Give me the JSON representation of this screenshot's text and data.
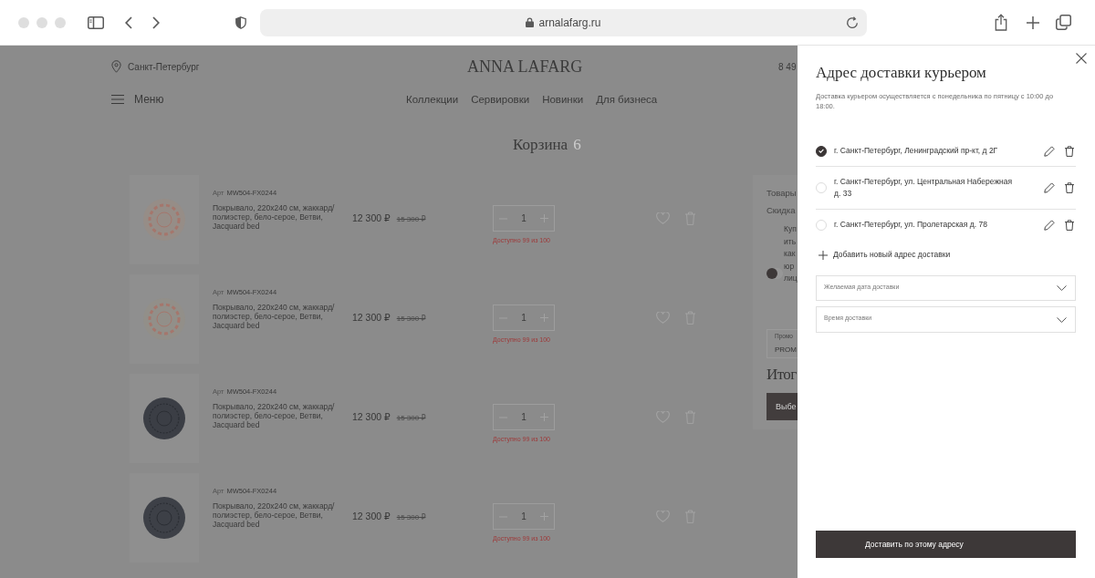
{
  "browser": {
    "url": "arnalafarg.ru"
  },
  "header": {
    "city": "Санкт-Петербург",
    "logo": "ANNA LAFARG",
    "phone": "8 49",
    "menu_label": "Меню",
    "nav": [
      "Коллекции",
      "Сервировки",
      "Новинки",
      "Для бизнеса"
    ]
  },
  "cart": {
    "title": "Корзина",
    "count": "6",
    "items": [
      {
        "article_label": "Арт",
        "article": "MW504-FX0244",
        "name": "Покрывало, 220х240 см, жаккард/полиэстер, бело-серое, Ветви, Jacquard bed",
        "price": "12 300 ₽",
        "old_price": "15 300 ₽",
        "quantity": "1",
        "stock": "Доступно 99 из 100",
        "photo": {
          "color": "#968d87"
        }
      },
      {
        "article_label": "Арт",
        "article": "MW504-FX0244",
        "name": "Покрывало, 220х240 см, жаккард/полиэстер, бело-серое, Ветви, Jacquard bed",
        "price": "12 300 ₽",
        "old_price": "15 300 ₽",
        "quantity": "1",
        "stock": "Доступно 99 из 100",
        "photo": {
          "color": "#928f89"
        }
      },
      {
        "article_label": "Арт",
        "article": "MW504-FX0244",
        "name": "Покрывало, 220х240 см, жаккард/полиэстер, бело-серое, Ветви, Jacquard bed",
        "price": "12 300 ₽",
        "old_price": "15 300 ₽",
        "quantity": "1",
        "stock": "Доступно 99 из 100",
        "photo": {
          "color": "#3b3e45"
        }
      },
      {
        "article_label": "Арт",
        "article": "MW504-FX0244",
        "name": "Покрывало, 220х240 см, жаккард/полиэстер, бело-серое, Ветви, Jacquard bed",
        "price": "12 300 ₽",
        "old_price": "15 300 ₽",
        "quantity": "1",
        "stock": "Доступно 99 из 100",
        "photo": {
          "color": "#3d4047"
        }
      }
    ]
  },
  "summary": {
    "lines": [
      "Товары",
      "Скидка"
    ],
    "legal_entity": {
      "label": "Купить как юр лиц",
      "on": false
    },
    "promo": {
      "label": "Промо",
      "value": "PROM"
    },
    "total_label": "Итог",
    "button": "Выбе"
  },
  "panel": {
    "title": "Адрес доставки курьером",
    "description": "Доставка курьером осуществляется с понедельника по пятницу с 10:00 до 18:00.",
    "addresses": [
      {
        "text": "г. Санкт-Петербург, Ленинградский пр-кт, д 2Г",
        "selected": true
      },
      {
        "text": "г. Санкт-Петербург, ул. Центральная Набережная д. 33",
        "selected": false
      },
      {
        "text": "г. Санкт-Петербург, ул. Пролетарская д. 78",
        "selected": false
      }
    ],
    "add_label": "Добавить новый адрес доставки",
    "selects": [
      {
        "placeholder": "Желаемая дата доставки"
      },
      {
        "placeholder": "Время доставки"
      }
    ],
    "submit": "Доставить по этому адресу"
  }
}
